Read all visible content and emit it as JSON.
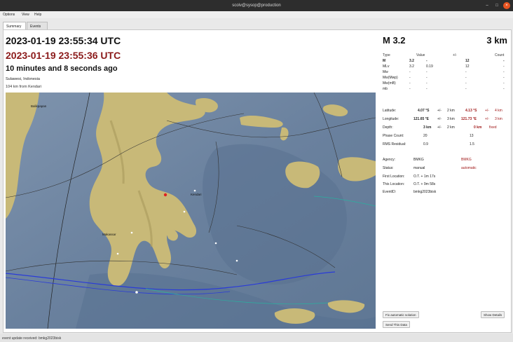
{
  "window": {
    "title": "scolv@sysop@production"
  },
  "menu": [
    "Options",
    "View",
    "Help"
  ],
  "tabs": [
    "Summary",
    "Events"
  ],
  "summary": {
    "origin_time": "2023-01-19 23:55:34 UTC",
    "event_time": "2023-01-19 23:55:36 UTC",
    "elapsed": "10 minutes and 8 seconds ago",
    "region": "Sulawesi, Indonesia",
    "distance": "104 km from Kendari"
  },
  "map": {
    "labels": {
      "north_city": "Balikpapan",
      "south_city": "Makassar",
      "kendari": "Kendari"
    }
  },
  "magnitude_panel": {
    "magnitude": "M 3.2",
    "depth_big": "3 km",
    "headers": [
      "Type",
      "Value",
      "+/-",
      "Count"
    ],
    "rows": [
      {
        "type": "M",
        "value": "3.2",
        "err": "-",
        "count": "12",
        "extra": "-"
      },
      {
        "type": "MLv",
        "value": "3.2",
        "err": "0.19",
        "count": "12",
        "extra": "-"
      },
      {
        "type": "Mw",
        "value": "-",
        "err": "-",
        "count": "-",
        "extra": "-"
      },
      {
        "type": "Mw(Mwp)",
        "value": "-",
        "err": "-",
        "count": "-",
        "extra": "-"
      },
      {
        "type": "Mw(mB)",
        "value": "-",
        "err": "-",
        "count": "-",
        "extra": "-"
      },
      {
        "type": "mb",
        "value": "-",
        "err": "-",
        "count": "-",
        "extra": "-"
      }
    ]
  },
  "origin": {
    "latitude": {
      "label": "Latitude:",
      "value": "4.07 °S",
      "pm": "+/-",
      "err": "2 km",
      "alt_value": "4.13 °S",
      "alt_pm": "+/-",
      "alt_err": "4 km"
    },
    "longitude": {
      "label": "Longitude:",
      "value": "121.65 °E",
      "pm": "+/-",
      "err": "3 km",
      "alt_value": "121.73 °E",
      "alt_pm": "+/-",
      "alt_err": "3 km"
    },
    "depth": {
      "label": "Depth:",
      "value": "3 km",
      "pm": "+/-",
      "err": "2 km",
      "alt_value": "0 km",
      "alt_note": "fixed"
    },
    "phase_count": {
      "label": "Phase Count:",
      "value": "20",
      "alt": "13"
    },
    "rms": {
      "label": "RMS Residual:",
      "value": "0.9",
      "alt": "1.5"
    },
    "agency": {
      "label": "Agency:",
      "value": "BMKG",
      "alt": "BMKG"
    },
    "status": {
      "label": "Status:",
      "value": "manual",
      "alt": "automatic"
    },
    "first_location": {
      "label": "First Location:",
      "value": "O.T. + 1m 17s"
    },
    "this_location": {
      "label": "This Location:",
      "value": "O.T. + 9m 58s"
    },
    "event_id": {
      "label": "EventID:",
      "value": "bmkg2023bisk"
    }
  },
  "buttons": {
    "fix_automatic": "Fix automatic solution",
    "show_details": "Show Details",
    "send_data": "Send This Data"
  },
  "statusbar": {
    "text": "event update received: bmkg2023bisk"
  },
  "colors": {
    "accent_red": "#a01818",
    "close_button": "#e95420",
    "sea": "#6e86a3",
    "land": "#c8b978"
  }
}
